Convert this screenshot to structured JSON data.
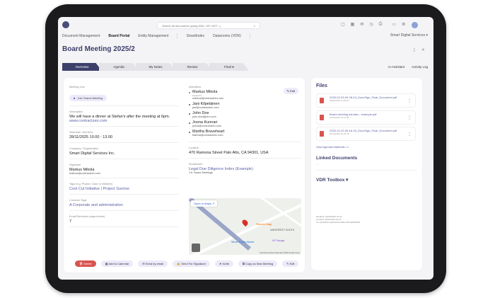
{
  "header": {
    "search_placeholder": "Search all documents (using AND, OR, NOT...)",
    "org": "Smart Digital Services ▾"
  },
  "nav": [
    "Document Management",
    "Board Portal",
    "Entity Management",
    "SmartIndex",
    "Datarooms (VDR)"
  ],
  "title": "Board Meeting 2025/2",
  "tabs": [
    "Overview",
    "Agenda",
    "My Notes",
    "Review",
    "Final ●"
  ],
  "right_tabs": [
    "AI Assistant",
    "Activity Log"
  ],
  "left": {
    "meeting_link_label": "Meeting Link",
    "teams_button": "Join Teams Meeting",
    "description_label": "Description",
    "description": "We will have a dinner at Stefan's after the meeting at 6pm.",
    "description_link": "www.contractzen.com",
    "time_label": "Start time -End time",
    "time": "28/11/2025 10.00 - 13.00",
    "company_label": "Company / Organization",
    "company": "Smart Digital Services Inc.",
    "organizer_label": "Organizer",
    "organizer": "Markus Mikola",
    "organizer_email": "markus@contractzen.com",
    "tags_label": "Tags (e.g. Project, Case or Initiative)",
    "tags": "Cost Cut Initiative | Project Sunrise",
    "common_tags_label": "Common Tags",
    "common_tags": "A Corporate and administration",
    "reminder_label": "Email Reminder (days before)",
    "reminder": "7"
  },
  "right": {
    "attendees_label": "Attendees",
    "edit": "Edit",
    "attendees": [
      {
        "name": "Markus Mikola",
        "role": "Organizer",
        "email": "markus@contractzen.com"
      },
      {
        "name": "Jani Kilpeläinen",
        "email": "jani@contractzen.com"
      },
      {
        "name": "John Doe",
        "email": "john.doe@john.com"
      },
      {
        "name": "Joona Kunnari",
        "email": "joona@contractzen.com"
      },
      {
        "name": "Martha Braveheart",
        "email": "Martha@contractzen.com"
      }
    ],
    "location_label": "Location",
    "location": "470 Ramona Street Palo Alto, CA 94301, USA",
    "smartindex_label": "SmartIndex",
    "smartindex": "Legal Due Diligence Index (Example)",
    "smartindex_sub": "1.6. Board Meetings",
    "map": {
      "open": "Open in Maps ↗",
      "label1": "Ramen Nagi",
      "label2": "UNIVERSITY SOUTH",
      "label3": "Whole Foods Market",
      "label4": "HP Garage",
      "attribution": "Keyboard shortcuts  Map data ©2025 Google  Terms"
    }
  },
  "actions": [
    "Delete",
    "Add to Calendar",
    "Send by email",
    "Send For Signature",
    "Invite",
    "Copy as New Meeting",
    "Edit"
  ],
  "files": {
    "title": "Files",
    "items": [
      {
        "name": "2025-02-03-09-28-24_DocuSign_Final_Document.pdf",
        "date": "03/02/2025 11.28.24"
      },
      {
        "name": "Board meeting minutes - example.pdf",
        "date": "22/10/2025 12.10.55"
      },
      {
        "name": "2025-10-22-09-18-18_DocuSign_Final_Document.pdf",
        "date": "22/10/2025 12.18.18"
      }
    ],
    "more": "View Agenda Materials >>"
  },
  "linked": {
    "title": "Linked Documents",
    "empty": "—"
  },
  "vdr": {
    "title": "VDR Toolbox ▾",
    "modified": "Modified: 19/03/2026 10.22",
    "created": "Created: 28/11/2024 16.44",
    "id": "ID: a27a6076-eab8-4216-a05e-0571a8d06303"
  }
}
